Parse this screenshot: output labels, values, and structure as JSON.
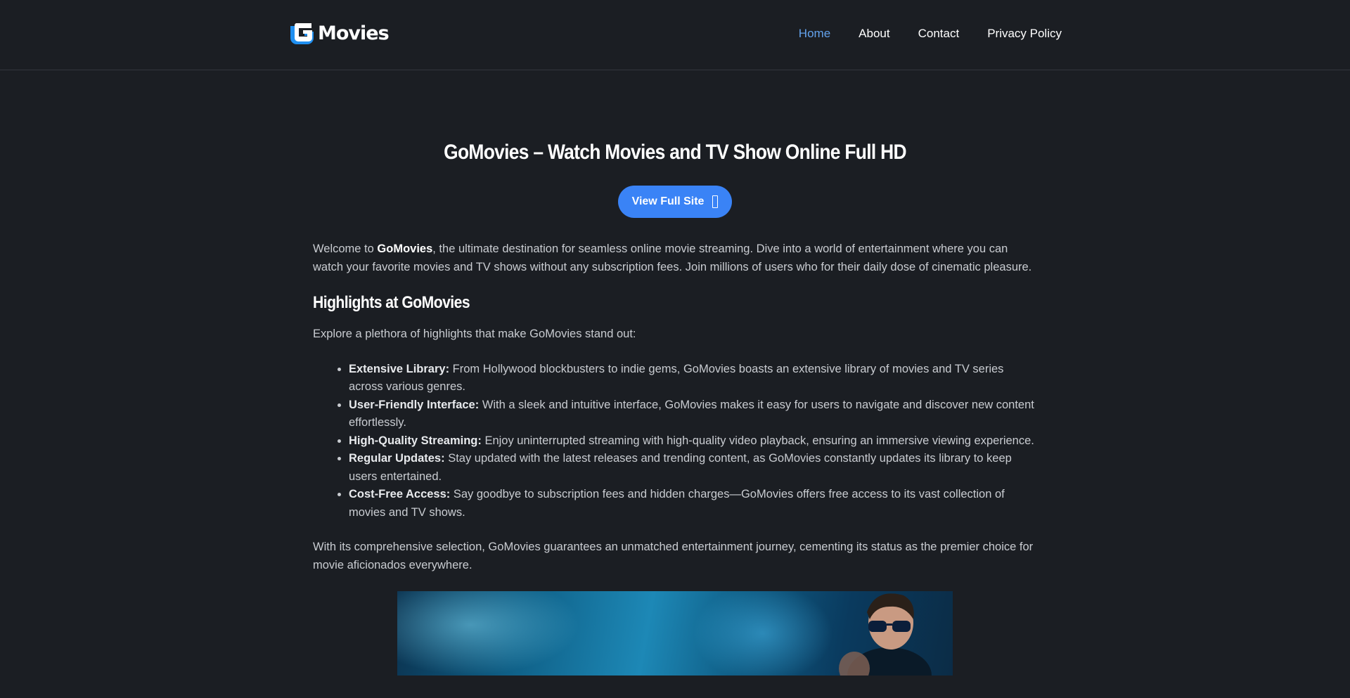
{
  "header": {
    "logo_text": "Movies",
    "nav": [
      {
        "label": "Home",
        "active": true
      },
      {
        "label": "About",
        "active": false
      },
      {
        "label": "Contact",
        "active": false
      },
      {
        "label": "Privacy Policy",
        "active": false
      }
    ]
  },
  "main": {
    "title": "GoMovies – Watch Movies and TV Show Online Full HD",
    "cta_label": "View Full Site",
    "intro": {
      "before": "Welcome to ",
      "brand": "GoMovies",
      "after": ", the ultimate destination for seamless online movie streaming. Dive into a world of entertainment where you can watch your favorite movies and TV shows without any subscription fees. Join millions of users who for their daily dose of cinematic pleasure."
    },
    "highlights_heading": "Highlights at GoMovies",
    "highlights_lead": "Explore a plethora of highlights that make GoMovies stand out:",
    "highlights": [
      {
        "term": "Extensive Library:",
        "text": " From Hollywood blockbusters to indie gems, GoMovies boasts an extensive library of movies and TV series across various genres."
      },
      {
        "term": "User-Friendly Interface:",
        "text": " With a sleek and intuitive interface, GoMovies makes it easy for users to navigate and discover new content effortlessly."
      },
      {
        "term": "High-Quality Streaming:",
        "text": " Enjoy uninterrupted streaming with high-quality video playback, ensuring an immersive viewing experience."
      },
      {
        "term": "Regular Updates:",
        "text": " Stay updated with the latest releases and trending content, as GoMovies constantly updates its library to keep users entertained."
      },
      {
        "term": "Cost-Free Access:",
        "text": " Say goodbye to subscription fees and hidden charges—GoMovies offers free access to its vast collection of movies and TV shows."
      }
    ],
    "closing": "With its comprehensive selection, GoMovies guarantees an unmatched entertainment journey, cementing its status as the premier choice for movie aficionados everywhere."
  },
  "colors": {
    "background": "#1b1e23",
    "accent": "#3a83f6",
    "active_nav": "#63a2ec",
    "text": "#c9ccd1"
  },
  "icons": {
    "logo_mark": "g-logo-icon",
    "cta": "external-link-icon"
  }
}
